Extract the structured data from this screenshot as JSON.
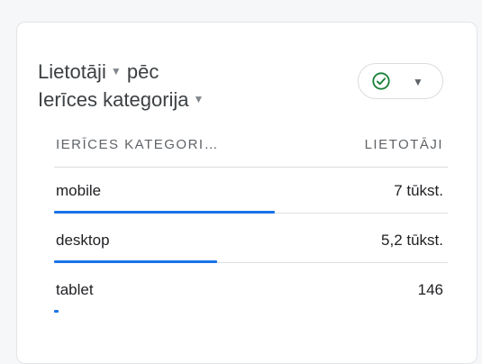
{
  "card": {
    "title_line1": "Lietotāji",
    "title_line1_suffix": "pēc",
    "title_line2": "Ierīces kategorija",
    "status_icon": "check-circle-icon",
    "status_color": "#188038",
    "accent_color": "#1a73e8"
  },
  "table": {
    "col_dimension": "IERĪCES KATEGORI…",
    "col_metric": "LIETOTĀJI",
    "rows": [
      {
        "label": "mobile",
        "value": "7 tūkst.",
        "share": 1.0
      },
      {
        "label": "desktop",
        "value": "5,2 tūkst.",
        "share": 0.74
      },
      {
        "label": "tablet",
        "value": "146",
        "share": 0.021
      }
    ]
  }
}
